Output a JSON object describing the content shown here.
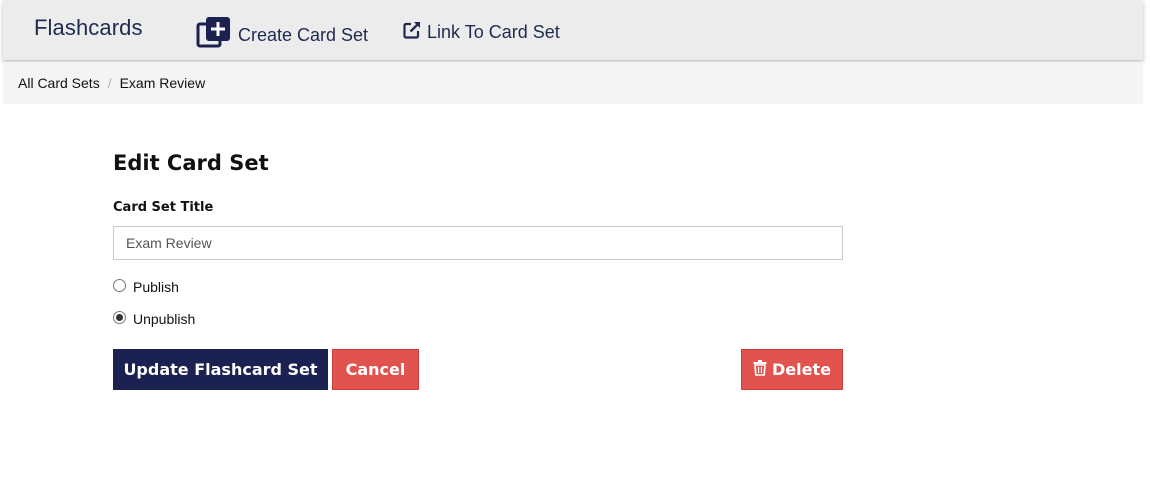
{
  "navbar": {
    "brand": "Flashcards",
    "create_label": "Create Card Set",
    "link_label": "Link To Card Set"
  },
  "breadcrumb": {
    "items": [
      "All Card Sets",
      "Exam Review"
    ],
    "separator": "/"
  },
  "form": {
    "heading": "Edit Card Set",
    "title_label": "Card Set Title",
    "title_value": "Exam Review",
    "radio_options": [
      {
        "label": "Publish",
        "checked": false
      },
      {
        "label": "Unpublish",
        "checked": true
      }
    ],
    "update_label": "Update Flashcard Set",
    "cancel_label": "Cancel",
    "delete_label": "Delete"
  },
  "colors": {
    "brand_navy": "#1b2150",
    "danger_red": "#e0534f",
    "navbar_bg": "#ececec"
  },
  "icons": {
    "create": "square-plus-icon",
    "link": "external-link-icon",
    "delete": "trash-icon"
  }
}
